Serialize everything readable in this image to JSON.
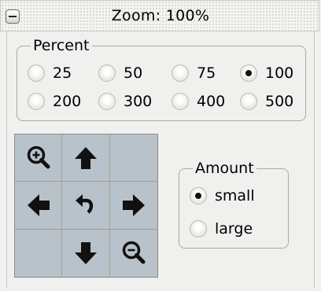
{
  "titlebar": {
    "title": "Zoom: 100%",
    "collapse_icon": "minus-icon"
  },
  "percent_group": {
    "title": "Percent",
    "options": [
      {
        "label": "25",
        "checked": false
      },
      {
        "label": "50",
        "checked": false
      },
      {
        "label": "75",
        "checked": false
      },
      {
        "label": "100",
        "checked": true
      },
      {
        "label": "200",
        "checked": false
      },
      {
        "label": "300",
        "checked": false
      },
      {
        "label": "400",
        "checked": false
      },
      {
        "label": "500",
        "checked": false
      }
    ]
  },
  "nav_pad": {
    "buttons": [
      "zoom-in-icon",
      "arrow-up-icon",
      "",
      "arrow-left-icon",
      "undo-icon",
      "arrow-right-icon",
      "",
      "arrow-down-icon",
      "zoom-out-icon"
    ],
    "background": "#b8c2ca"
  },
  "amount_group": {
    "title": "Amount",
    "options": [
      {
        "label": "small",
        "checked": true
      },
      {
        "label": "large",
        "checked": false
      }
    ]
  }
}
